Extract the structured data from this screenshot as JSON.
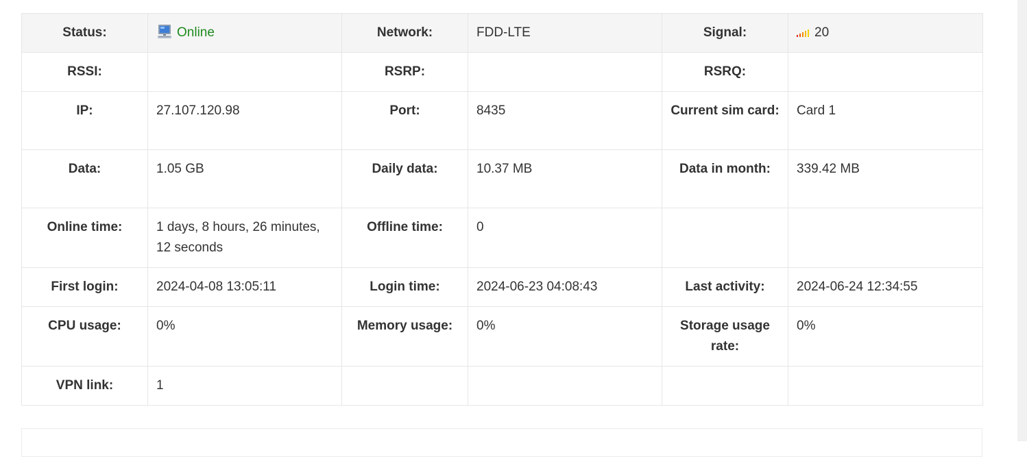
{
  "status": {
    "label": "Status:",
    "value": "Online",
    "icon": "computer-icon",
    "color": "#1e8a1e"
  },
  "network": {
    "label": "Network:",
    "value": "FDD-LTE"
  },
  "signal": {
    "label": "Signal:",
    "value": "20",
    "icon": "signal-bars-icon"
  },
  "rssi": {
    "label": "RSSI:",
    "value": ""
  },
  "rsrp": {
    "label": "RSRP:",
    "value": ""
  },
  "rsrq": {
    "label": "RSRQ:",
    "value": ""
  },
  "ip": {
    "label": "IP:",
    "value": "27.107.120.98"
  },
  "port": {
    "label": "Port:",
    "value": "8435"
  },
  "sim": {
    "label": "Current sim card:",
    "value": "Card 1"
  },
  "data": {
    "label": "Data:",
    "value": "1.05 GB"
  },
  "daily_data": {
    "label": "Daily data:",
    "value": "10.37 MB"
  },
  "month_data": {
    "label": "Data in month:",
    "value": "339.42 MB"
  },
  "online_time": {
    "label": "Online time:",
    "value": "1 days, 8 hours, 26 minutes, 12 seconds"
  },
  "offline_time": {
    "label": "Offline time:",
    "value": "0"
  },
  "first_login": {
    "label": "First login:",
    "value": "2024-04-08 13:05:11"
  },
  "login_time": {
    "label": "Login time:",
    "value": "2024-06-23 04:08:43"
  },
  "last_activity": {
    "label": "Last activity:",
    "value": "2024-06-24 12:34:55"
  },
  "cpu": {
    "label": "CPU usage:",
    "value": "0%"
  },
  "memory": {
    "label": "Memory usage:",
    "value": "0%"
  },
  "storage": {
    "label": "Storage usage rate:",
    "value": "0%"
  },
  "vpn": {
    "label": "VPN link:",
    "value": "1"
  }
}
